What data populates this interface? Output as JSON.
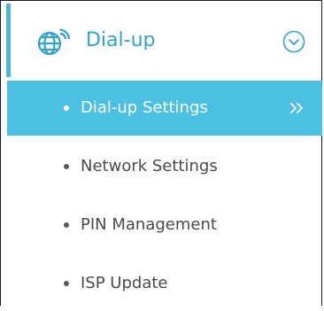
{
  "menu": {
    "header": {
      "label": "Dial-up",
      "icon": "globe-wifi-icon",
      "expand_icon": "chevron-down-circle-icon"
    },
    "items": [
      {
        "label": "Dial-up Settings",
        "active": true,
        "icon": "double-chevron-right-icon"
      },
      {
        "label": "Network Settings",
        "active": false
      },
      {
        "label": "PIN Management",
        "active": false
      },
      {
        "label": "ISP Update",
        "active": false
      }
    ]
  },
  "colors": {
    "accent": "#4cb8da",
    "header_text": "#2fa3cd",
    "active_background": "#4cc0e3",
    "item_text": "#4a4a4a",
    "active_text": "#ffffff"
  }
}
